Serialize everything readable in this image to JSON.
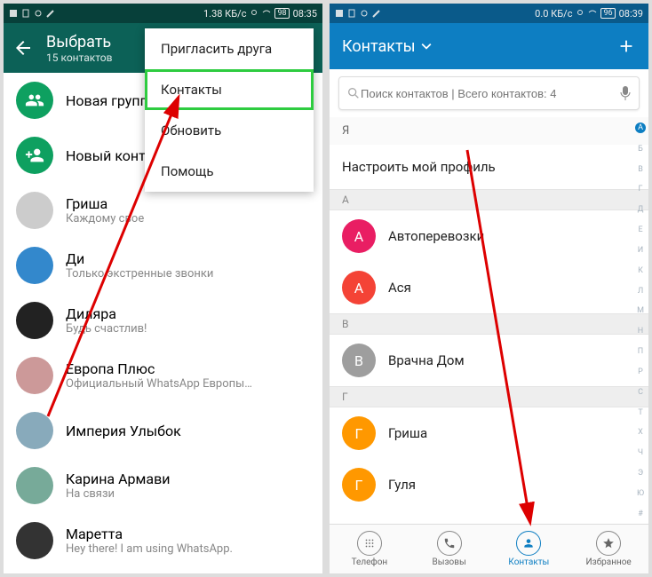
{
  "left": {
    "status": {
      "speed": "1.38 КБ/с",
      "battery": "98",
      "time": "08:35"
    },
    "header": {
      "title": "Выбрать",
      "subtitle": "15 контактов"
    },
    "menu": {
      "items": [
        "Пригласить друга",
        "Контакты",
        "Обновить",
        "Помощь"
      ]
    },
    "rows": [
      {
        "name": "Новая группа",
        "sub": "",
        "sys": true,
        "icon": "group"
      },
      {
        "name": "Новый контакт",
        "sub": "",
        "sys": true,
        "icon": "add"
      },
      {
        "name": "Гриша",
        "sub": "Каждому свое"
      },
      {
        "name": "Ди",
        "sub": "Только экстренные звонки"
      },
      {
        "name": "Диляра",
        "sub": "Будь счастлив!"
      },
      {
        "name": "Европа Плюс",
        "sub": "Официальный WhatsApp Европы…"
      },
      {
        "name": "Империя Улыбок",
        "sub": ""
      },
      {
        "name": "Карина Армави",
        "sub": "На связи"
      },
      {
        "name": "Маретта",
        "sub": "Hey there! I am using WhatsApp."
      }
    ]
  },
  "right": {
    "status": {
      "speed": "0.0 КБ/с",
      "battery": "96",
      "time": "08:39"
    },
    "header": {
      "title": "Контакты"
    },
    "search": {
      "placeholder": "Поиск контактов | Всего контактов: 4"
    },
    "profile": "Настроить мой профиль",
    "section_self": "Я",
    "groups": [
      {
        "letter": "А",
        "items": [
          {
            "name": "Автоперевозки",
            "color": "#e91e63"
          },
          {
            "name": "Ася",
            "color": "#f44336"
          }
        ]
      },
      {
        "letter": "В",
        "items": [
          {
            "name": "Врачна Дом",
            "color": "#9e9e9e"
          }
        ]
      },
      {
        "letter": "Г",
        "items": [
          {
            "name": "Гриша",
            "color": "#ff9800"
          },
          {
            "name": "Гуля",
            "color": "#ff9800"
          }
        ]
      }
    ],
    "index": [
      "А",
      "Б",
      "В",
      "Г",
      "Д",
      "Е",
      "И",
      "К",
      "Л",
      "М",
      "Н",
      "П",
      "Р",
      "С",
      "Т",
      "Х",
      "Ч",
      "Э",
      "Ю",
      "#"
    ],
    "nav": {
      "items": [
        {
          "label": "Телефон",
          "icon": "dial"
        },
        {
          "label": "Вызовы",
          "icon": "call"
        },
        {
          "label": "Контакты",
          "icon": "person",
          "active": true
        },
        {
          "label": "Избранное",
          "icon": "star"
        }
      ]
    }
  }
}
